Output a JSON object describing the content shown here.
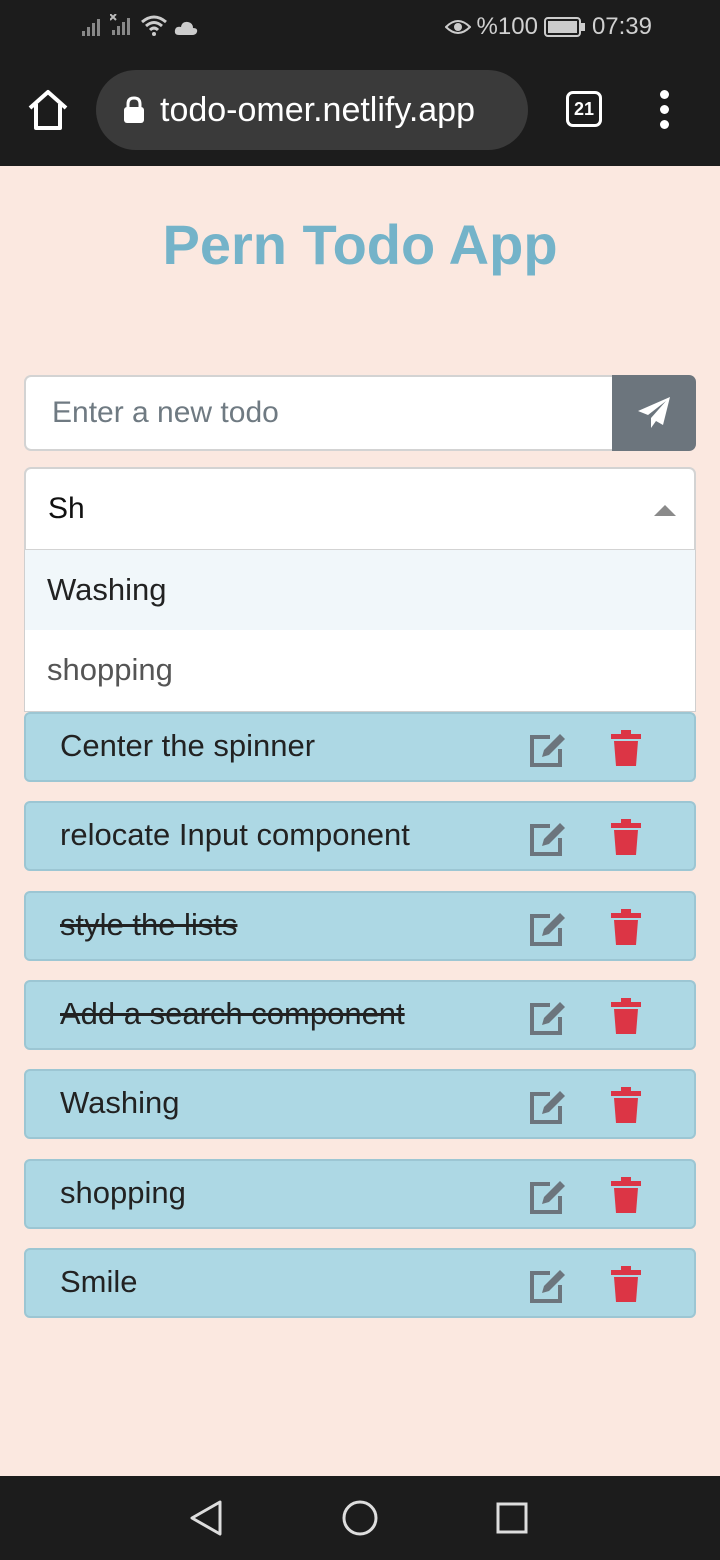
{
  "status_bar": {
    "battery": "%100",
    "time": "07:39",
    "icons": [
      "signal-icon",
      "no-signal-icon",
      "wifi-icon",
      "cloud-icon",
      "eye-icon",
      "battery-icon"
    ]
  },
  "browser": {
    "url": "todo-omer.netlify.app",
    "tab_count": "21",
    "icons": [
      "home-icon",
      "lock-icon",
      "tabs-icon",
      "menu-icon"
    ]
  },
  "app": {
    "title": "Pern Todo App",
    "input_placeholder": "Enter a new todo",
    "search_value": "Sh",
    "dropdown_options": [
      {
        "label": "Washing",
        "highlighted": true
      },
      {
        "label": "shopping",
        "highlighted": false
      }
    ],
    "todos": [
      {
        "text": "Center the spinner",
        "completed": false
      },
      {
        "text": "relocate Input component",
        "completed": false
      },
      {
        "text": "style the lists",
        "completed": true
      },
      {
        "text": "Add a search component",
        "completed": true
      },
      {
        "text": "Washing",
        "completed": false
      },
      {
        "text": "shopping",
        "completed": false
      },
      {
        "text": "Smile",
        "completed": false
      }
    ]
  },
  "colors": {
    "page_bg": "#fbe8e0",
    "title": "#74b3c9",
    "todo_bg": "#add8e4",
    "delete": "#dc3545",
    "edit": "#6c757d"
  },
  "nav": {
    "icons": [
      "back-icon",
      "home-circle-icon",
      "recents-icon"
    ]
  }
}
